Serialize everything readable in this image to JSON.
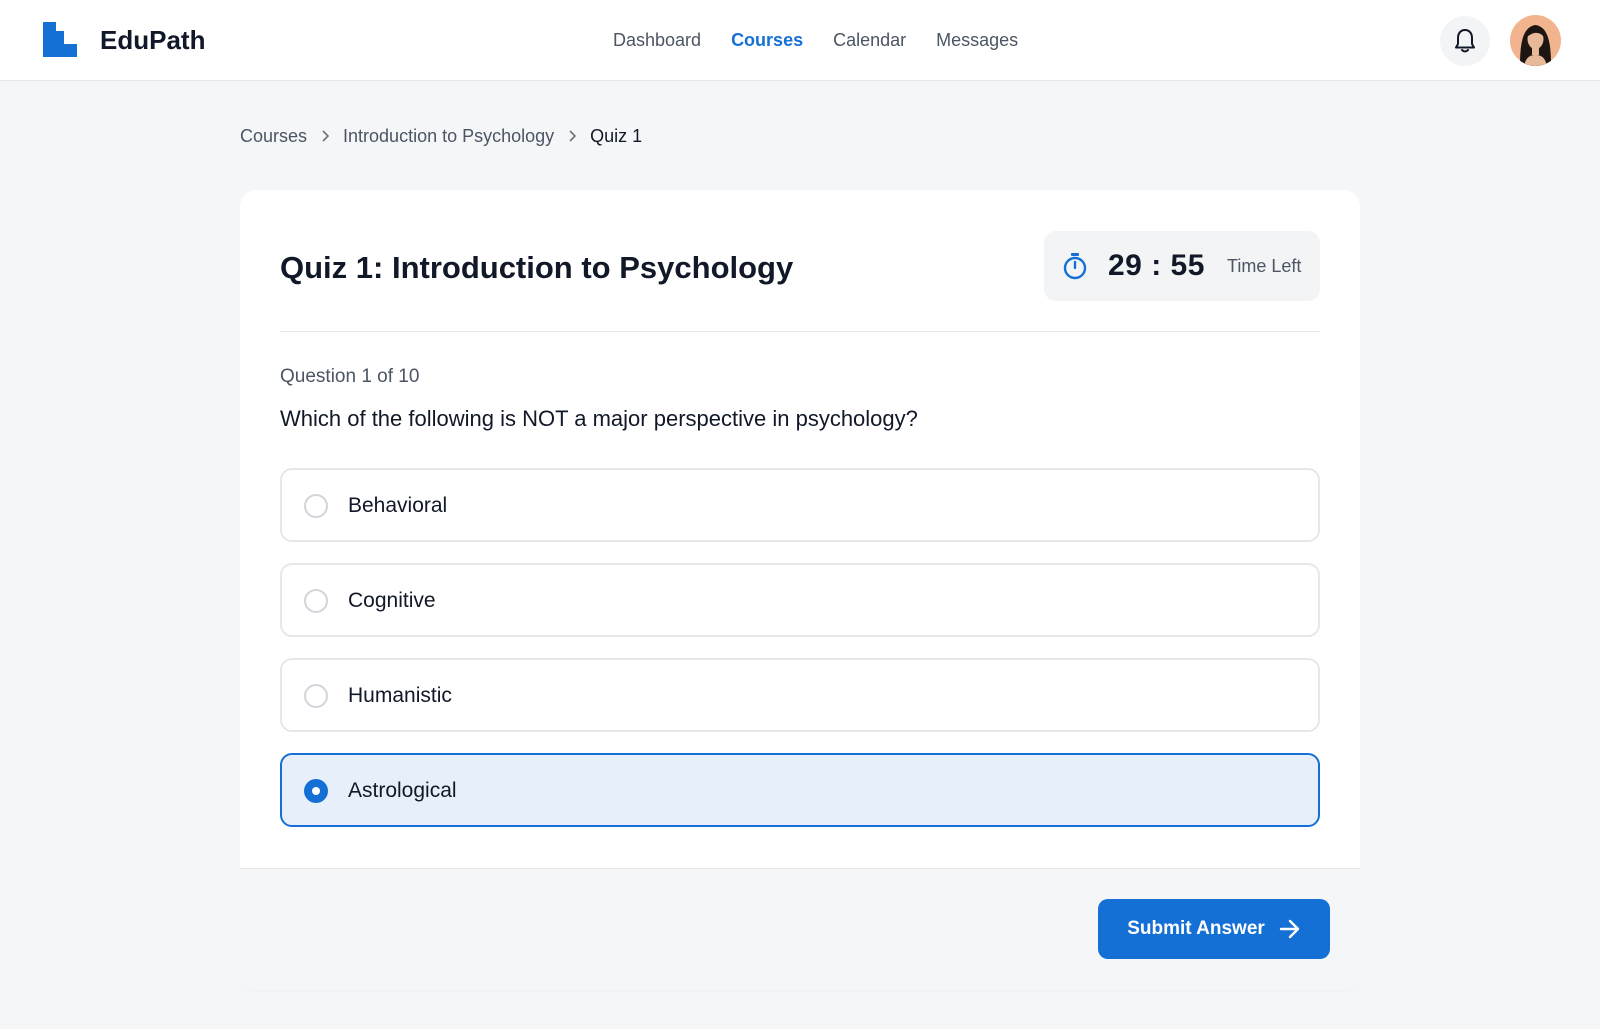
{
  "brand": {
    "name": "EduPath",
    "icon": "edupath-logo",
    "color": "#1570d6"
  },
  "nav": {
    "items": [
      {
        "label": "Dashboard",
        "active": false
      },
      {
        "label": "Courses",
        "active": true
      },
      {
        "label": "Calendar",
        "active": false
      },
      {
        "label": "Messages",
        "active": false
      }
    ]
  },
  "header_actions": {
    "notifications_icon": "bell-icon",
    "avatar_icon": "user-avatar"
  },
  "breadcrumb": [
    "Courses",
    "Introduction to Psychology",
    "Quiz 1"
  ],
  "quiz": {
    "title": "Quiz 1: Introduction to Psychology",
    "timer": {
      "value": "29 : 55",
      "label": "Time Left",
      "icon": "stopwatch-icon"
    },
    "question_counter": "Question 1 of 10",
    "question": "Which of the following is NOT a major perspective in psychology?",
    "options": [
      {
        "label": "Behavioral",
        "selected": false
      },
      {
        "label": "Cognitive",
        "selected": false
      },
      {
        "label": "Humanistic",
        "selected": false
      },
      {
        "label": "Astrological",
        "selected": true
      }
    ],
    "submit_label": "Submit Answer"
  },
  "colors": {
    "accent": "#1570d6",
    "selected_bg": "#e7f0fa",
    "page_bg": "#f5f6f8"
  }
}
